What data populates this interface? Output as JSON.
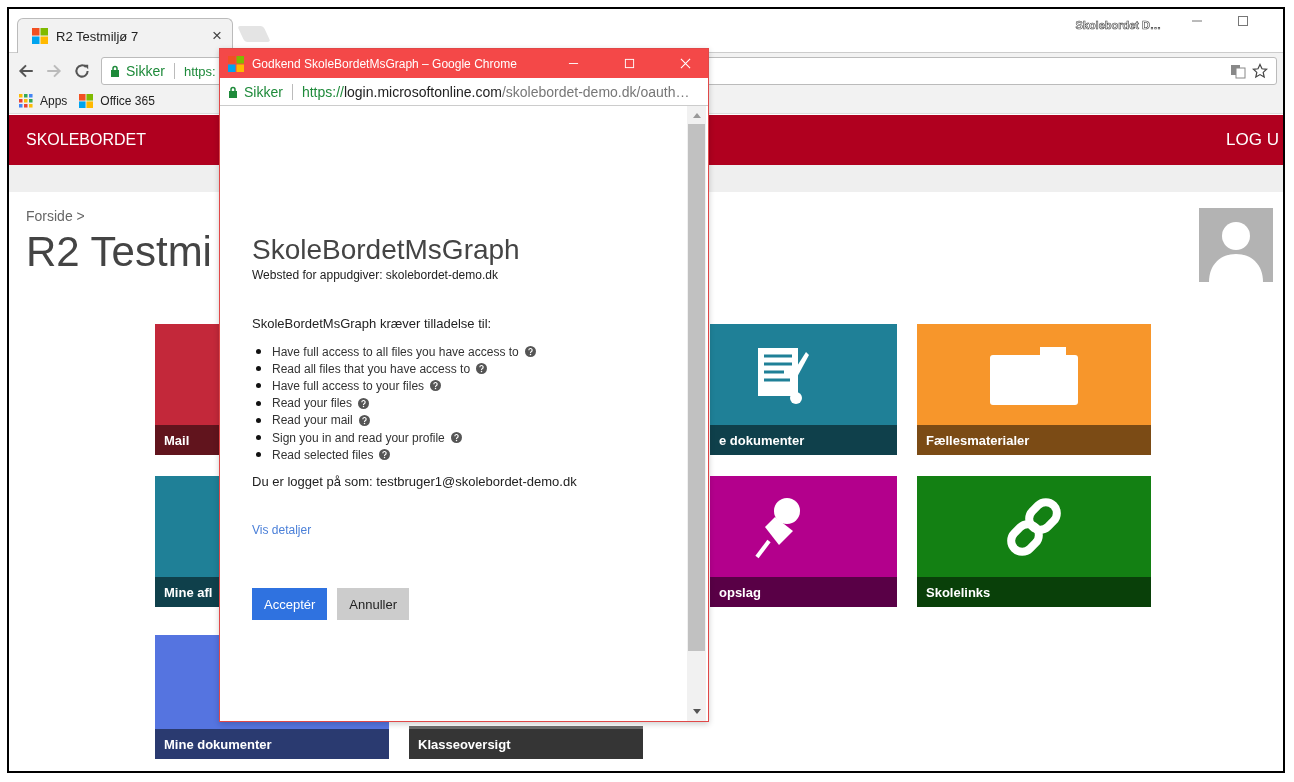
{
  "browser": {
    "tab_title": "R2 Testmiljø 7",
    "tab_close": "×",
    "window_owner": "Skolebordet D…",
    "secure_label": "Sikker",
    "url": "https:",
    "bookmarks": [
      "Apps",
      "Office 365"
    ]
  },
  "site": {
    "brand": "SKOLEBORDET",
    "logout": "LOG U",
    "breadcrumb": "Forside >",
    "title": "R2 Testmi",
    "tiles": [
      {
        "label": "Mail",
        "color": "#c3283a",
        "kind": "plain"
      },
      {
        "label": "e dokumenter",
        "color": "#1f8097",
        "kind": "document"
      },
      {
        "label": "Fællesmaterialer",
        "color": "#f7962b",
        "kind": "folder"
      },
      {
        "label": "Mine afl",
        "color": "#1f8097",
        "kind": "plain"
      },
      {
        "label": "opslag",
        "color": "#b3008c",
        "kind": "pin"
      },
      {
        "label": "Skolelinks",
        "color": "#138013",
        "kind": "link"
      },
      {
        "label": "Mine dokumenter",
        "color": "#5574e0",
        "kind": "plain"
      },
      {
        "label": "Klasseoversigt",
        "color": "#6b6b6b",
        "kind": "plain"
      }
    ]
  },
  "dialog": {
    "window_title": "Godkend SkoleBordetMsGraph – Google Chrome",
    "secure_label": "Sikker",
    "url_scheme": "https://",
    "url_host": "login.microsoftonline.com",
    "url_path": "/skolebordet-demo.dk/oauth…",
    "app_name": "SkoleBordetMsGraph",
    "publisher": "Websted for appudgiver: skolebordet-demo.dk",
    "permissions_heading": "SkoleBordetMsGraph kræver tilladelse til:",
    "permissions": [
      "Have full access to all files you have access to",
      "Read all files that you have access to",
      "Have full access to your files",
      "Read your files",
      "Read your mail",
      "Sign you in and read your profile",
      "Read selected files"
    ],
    "signed_in": "Du er logget på som: testbruger1@skolebordet-demo.dk",
    "details_link": "Vis detaljer",
    "buttons": [
      {
        "label": "Acceptér",
        "kind": "primary"
      },
      {
        "label": "Annuller",
        "kind": "secondary"
      }
    ]
  }
}
